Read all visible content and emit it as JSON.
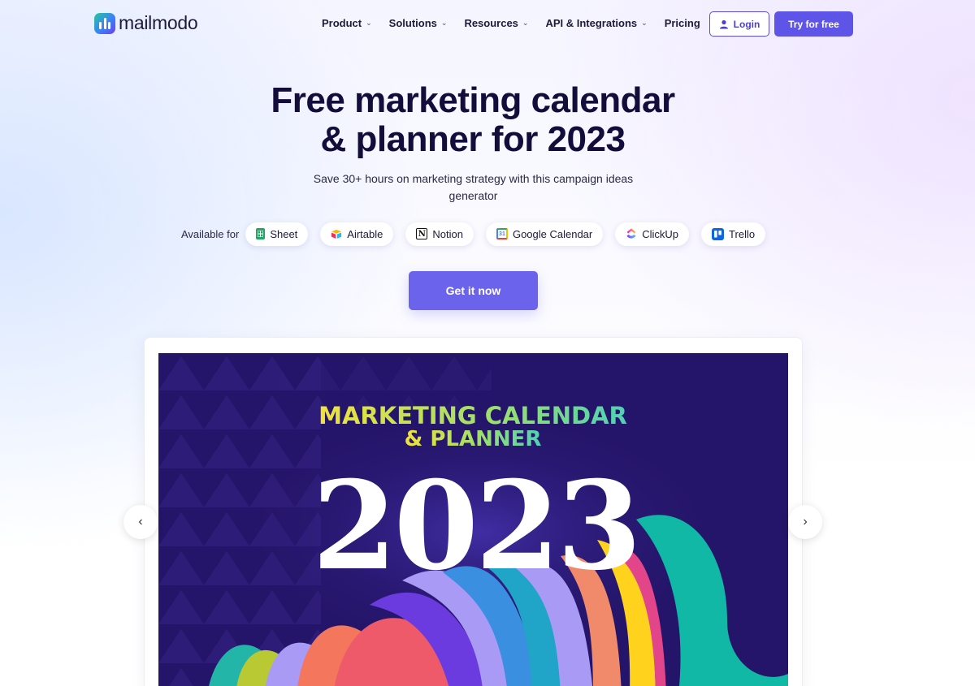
{
  "brand": {
    "name": "mailmodo"
  },
  "nav": {
    "menu": [
      {
        "label": "Product",
        "icon": "chevron-down-icon"
      },
      {
        "label": "Solutions",
        "icon": "chevron-down-icon"
      },
      {
        "label": "Resources",
        "icon": "chevron-down-icon"
      },
      {
        "label": "API & Integrations",
        "icon": "chevron-down-icon"
      },
      {
        "label": "Pricing"
      }
    ],
    "login_label": "Login",
    "try_label": "Try for free"
  },
  "hero": {
    "title_line1": "Free marketing calendar",
    "title_line2": "& planner for 2023",
    "subtitle": "Save 30+ hours on marketing strategy with this campaign ideas generator",
    "available_label": "Available for",
    "platforms": [
      {
        "label": "Sheet",
        "icon": "sheets-icon"
      },
      {
        "label": "Airtable",
        "icon": "airtable-icon"
      },
      {
        "label": "Notion",
        "icon": "notion-icon"
      },
      {
        "label": "Google Calendar",
        "icon": "google-calendar-icon"
      },
      {
        "label": "ClickUp",
        "icon": "clickup-icon"
      },
      {
        "label": "Trello",
        "icon": "trello-icon"
      }
    ],
    "cta_label": "Get it now"
  },
  "carousel": {
    "slide_title_line1": "MARKETING CALENDAR",
    "slide_title_line2": "& PLANNER",
    "slide_year": "2023",
    "prev_icon": "chevron-left-icon",
    "next_icon": "chevron-right-icon"
  },
  "colors": {
    "accent": "#5e55e8",
    "slide_bg": "#25156a"
  }
}
